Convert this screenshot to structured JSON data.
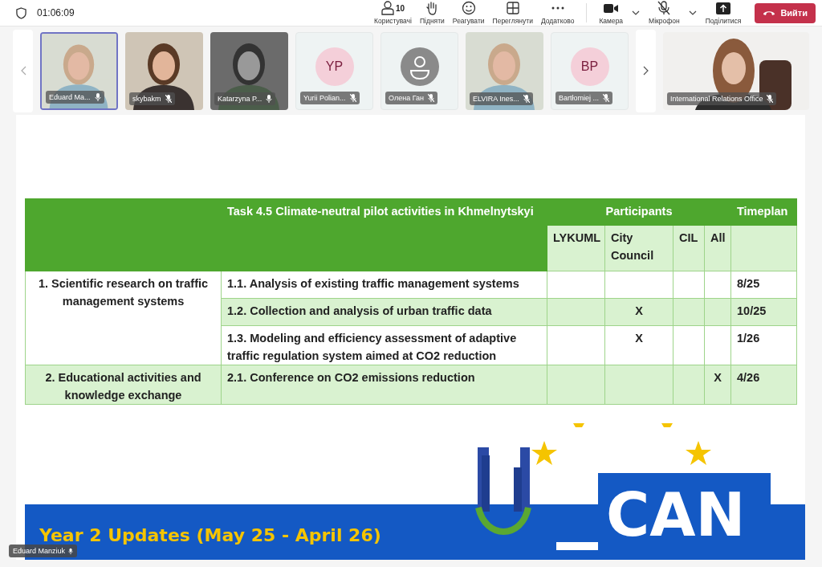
{
  "top_bar": {
    "time": "01:06:09",
    "tools": [
      {
        "kind": "people",
        "label": "Користувачі",
        "count": "10"
      },
      {
        "kind": "hand",
        "label": "Підняти"
      },
      {
        "kind": "react",
        "label": "Реагувати"
      },
      {
        "kind": "view",
        "label": "Переглянути"
      },
      {
        "kind": "more",
        "label": "Додатково"
      },
      {
        "kind": "camera",
        "label": "Камера",
        "dropdown": true
      },
      {
        "kind": "mic",
        "label": "Мікрофон",
        "dropdown": true,
        "muted": true
      },
      {
        "kind": "share",
        "label": "Поділитися"
      }
    ],
    "leave_button": "Вийти"
  },
  "participants": [
    {
      "kind": "video",
      "name": "Eduard Ma...",
      "muted": false,
      "selected": true
    },
    {
      "kind": "video",
      "name": "skybakm",
      "muted": true,
      "selected": false
    },
    {
      "kind": "video",
      "name": "Katarzyna P...",
      "muted": false,
      "selected": false
    },
    {
      "kind": "initials",
      "initials": "YP",
      "name": "Yurii Polian...",
      "muted": true,
      "selected": false
    },
    {
      "kind": "icon",
      "name": "Олена Ган",
      "muted": true,
      "selected": false
    },
    {
      "kind": "video",
      "name": "ELVIRA Ines...",
      "muted": true,
      "selected": false
    },
    {
      "kind": "initials",
      "initials": "BP",
      "name": "Bartłomiej ...",
      "muted": true,
      "selected": false
    }
  ],
  "pinned": {
    "kind": "video",
    "name": "International Relations Office",
    "muted": true
  },
  "slide": {
    "table": {
      "task_header": "Task 4.5 Climate-neutral pilot activities in Khmelnytskyi",
      "participants_header": "Participants",
      "timeplan_header": "Timeplan",
      "participant_columns": [
        "LYKUML",
        "City Council",
        "CIL",
        "All"
      ],
      "groups": [
        {
          "label": "1. Scientific research on traffic management systems",
          "shaded": false,
          "tasks": [
            {
              "task": "1.1. Analysis of existing traffic management systems",
              "timeplan": "8/25",
              "shaded": false
            },
            {
              "task": "1.2. Collection and analysis of urban traffic data",
              "city_council": "X",
              "timeplan": "10/25",
              "shaded": true
            },
            {
              "task": "1.3. Modeling and efficiency assessment of adaptive traffic regulation system aimed at CO2 reduction",
              "city_council": "X",
              "timeplan": "1/26",
              "shaded": false
            }
          ]
        },
        {
          "label": "2. Educational activities and knowledge exchange",
          "shaded": true,
          "tasks": [
            {
              "task": "2.1. Conference on CO2 emissions reduction",
              "all": "X",
              "timeplan": "4/26",
              "shaded": true
            }
          ]
        }
      ]
    },
    "banner_title": "Year 2 Updates (May 25 - April 26)",
    "logo_text": "CAN"
  },
  "speaker": {
    "name": "Eduard Manziuk",
    "muted": false
  }
}
